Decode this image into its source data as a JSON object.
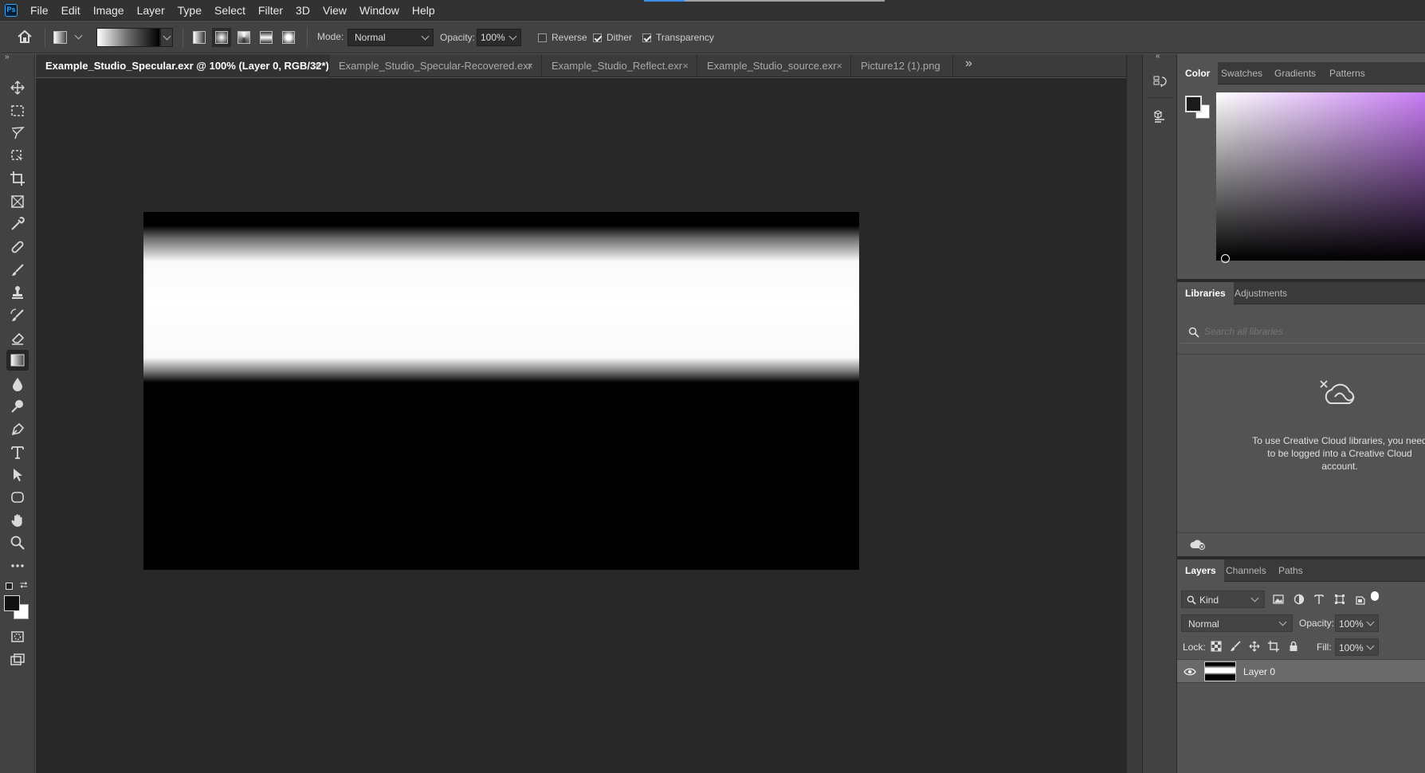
{
  "app": {
    "logo_text": "Ps"
  },
  "menu": [
    "File",
    "Edit",
    "Image",
    "Layer",
    "Type",
    "Select",
    "Filter",
    "3D",
    "View",
    "Window",
    "Help"
  ],
  "menu_progress": 0.17,
  "options": {
    "mode_label": "Mode:",
    "mode_value": "Normal",
    "opacity_label": "Opacity:",
    "opacity_value": "100%",
    "reverse_label": "Reverse",
    "reverse_checked": false,
    "dither_label": "Dither",
    "dither_checked": true,
    "transparency_label": "Transparency",
    "transparency_checked": true
  },
  "tools": [
    "move-tool",
    "marquee-tool",
    "lasso-tool",
    "object-select-tool",
    "crop-tool",
    "frame-tool",
    "eyedropper-tool",
    "healing-brush-tool",
    "brush-tool",
    "clone-stamp-tool",
    "history-brush-tool",
    "eraser-tool",
    "gradient-tool",
    "blur-tool",
    "dodge-tool",
    "pen-tool",
    "type-tool",
    "path-select-tool",
    "shape-tool",
    "hand-tool",
    "zoom-tool",
    "more-tools"
  ],
  "active_tool": "gradient-tool",
  "doc_tabs": [
    {
      "label": "Example_Studio_Specular.exr @ 100% (Layer 0, RGB/32*) *",
      "active": true
    },
    {
      "label": "Example_Studio_Specular-Recovered.exr",
      "active": false
    },
    {
      "label": "Example_Studio_Reflect.exr",
      "active": false
    },
    {
      "label": "Example_Studio_source.exr",
      "active": false
    },
    {
      "label": "Picture12 (1).png",
      "active": false
    }
  ],
  "tab_close_glyph": "×",
  "color_panel": {
    "tabs": [
      "Color",
      "Swatches",
      "Gradients",
      "Patterns"
    ],
    "active_tab": "Color",
    "foreground": "#1a1a1a",
    "background": "#ffffff",
    "hue_color": "#c87cf5"
  },
  "libraries_panel": {
    "tabs": [
      "Libraries",
      "Adjustments"
    ],
    "active_tab": "Libraries",
    "search_placeholder": "Search all libraries",
    "message": "To use Creative Cloud libraries, you need to be logged into a Creative Cloud account."
  },
  "layers_panel": {
    "tabs": [
      "Layers",
      "Channels",
      "Paths"
    ],
    "active_tab": "Layers",
    "filter_kind": "Kind",
    "blend_mode": "Normal",
    "opacity_label": "Opacity:",
    "opacity_value": "100%",
    "lock_label": "Lock:",
    "fill_label": "Fill:",
    "fill_value": "100%",
    "layers": [
      {
        "name": "Layer 0",
        "visible": true
      }
    ]
  }
}
